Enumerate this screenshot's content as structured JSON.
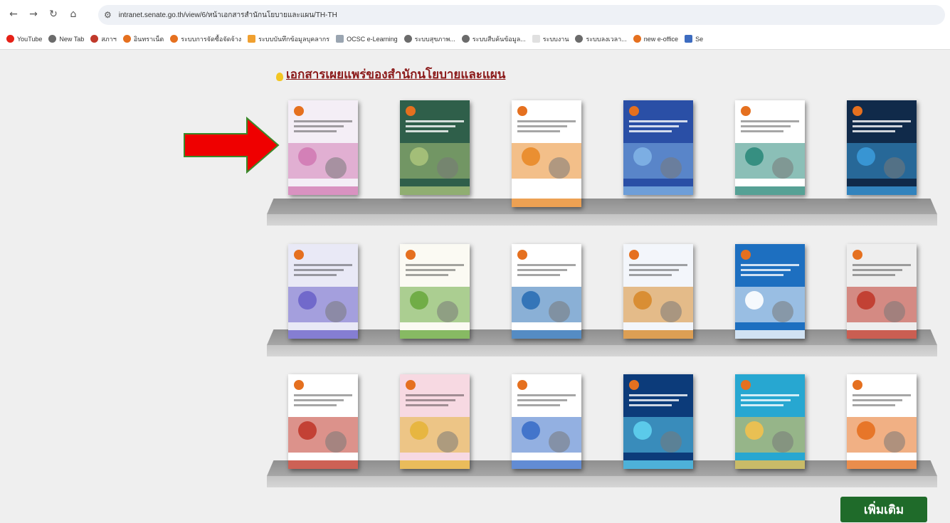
{
  "browser": {
    "url": "intranet.senate.go.th/view/6/หน้าเอกสารสำนักนโยบายและแผน/TH-TH",
    "bookmarks": [
      {
        "label": "YouTube",
        "color": "#e62117"
      },
      {
        "label": "New Tab",
        "color": "#6b6b6b"
      },
      {
        "label": "สภาฯ",
        "color": "#c0392b"
      },
      {
        "label": "อินทราเน็ต",
        "color": "#e5701f"
      },
      {
        "label": "ระบบการจัดซื้อจัดจ้าง",
        "color": "#e5701f"
      },
      {
        "label": "ระบบบันทึกข้อมูลบุคลากร",
        "color": "#f0a030"
      },
      {
        "label": "OCSC e-Learning",
        "color": "#9aa5b1"
      },
      {
        "label": "ระบบสุขภาพ...",
        "color": "#6b6b6b"
      },
      {
        "label": "ระบบสืบค้นข้อมูล...",
        "color": "#6b6b6b"
      },
      {
        "label": "ระบบงาน",
        "color": "#e0e0e0"
      },
      {
        "label": "ระบบลงเวลา...",
        "color": "#6b6b6b"
      },
      {
        "label": "new e-office",
        "color": "#e5701f"
      },
      {
        "label": "Se",
        "color": "#3d6cc0"
      }
    ]
  },
  "page": {
    "heading": "เอกสารเผยแพร่ของสำนักนโยบายและแผน",
    "more_button": "เพิ่มเติม"
  },
  "books": [
    {
      "bg": "#f4eef6",
      "accent": "#d27bb4"
    },
    {
      "bg": "#2f5f4a",
      "accent": "#a9c27a"
    },
    {
      "bg": "#ffffff",
      "accent": "#e98a28"
    },
    {
      "bg": "#2a4fa6",
      "accent": "#7fb2e5"
    },
    {
      "bg": "#ffffff",
      "accent": "#2c8a7b"
    },
    {
      "bg": "#102a4a",
      "accent": "#3b9ad9"
    },
    {
      "bg": "#e9e9f6",
      "accent": "#6b63c9"
    },
    {
      "bg": "#fbfaf3",
      "accent": "#6aaa3f"
    },
    {
      "bg": "#ffffff",
      "accent": "#2a6fb5"
    },
    {
      "bg": "#f3f6fb",
      "accent": "#d78a2b"
    },
    {
      "bg": "#1d6fc0",
      "accent": "#ffffff"
    },
    {
      "bg": "#eeeeee",
      "accent": "#c0392b"
    },
    {
      "bg": "#ffffff",
      "accent": "#c0392b"
    },
    {
      "bg": "#f7d9e2",
      "accent": "#e6b43a"
    },
    {
      "bg": "#ffffff",
      "accent": "#3b6fc9"
    },
    {
      "bg": "#0c3b7a",
      "accent": "#5fd0f0"
    },
    {
      "bg": "#27a7d1",
      "accent": "#f2c14e"
    },
    {
      "bg": "#ffffff",
      "accent": "#e5701f"
    }
  ]
}
